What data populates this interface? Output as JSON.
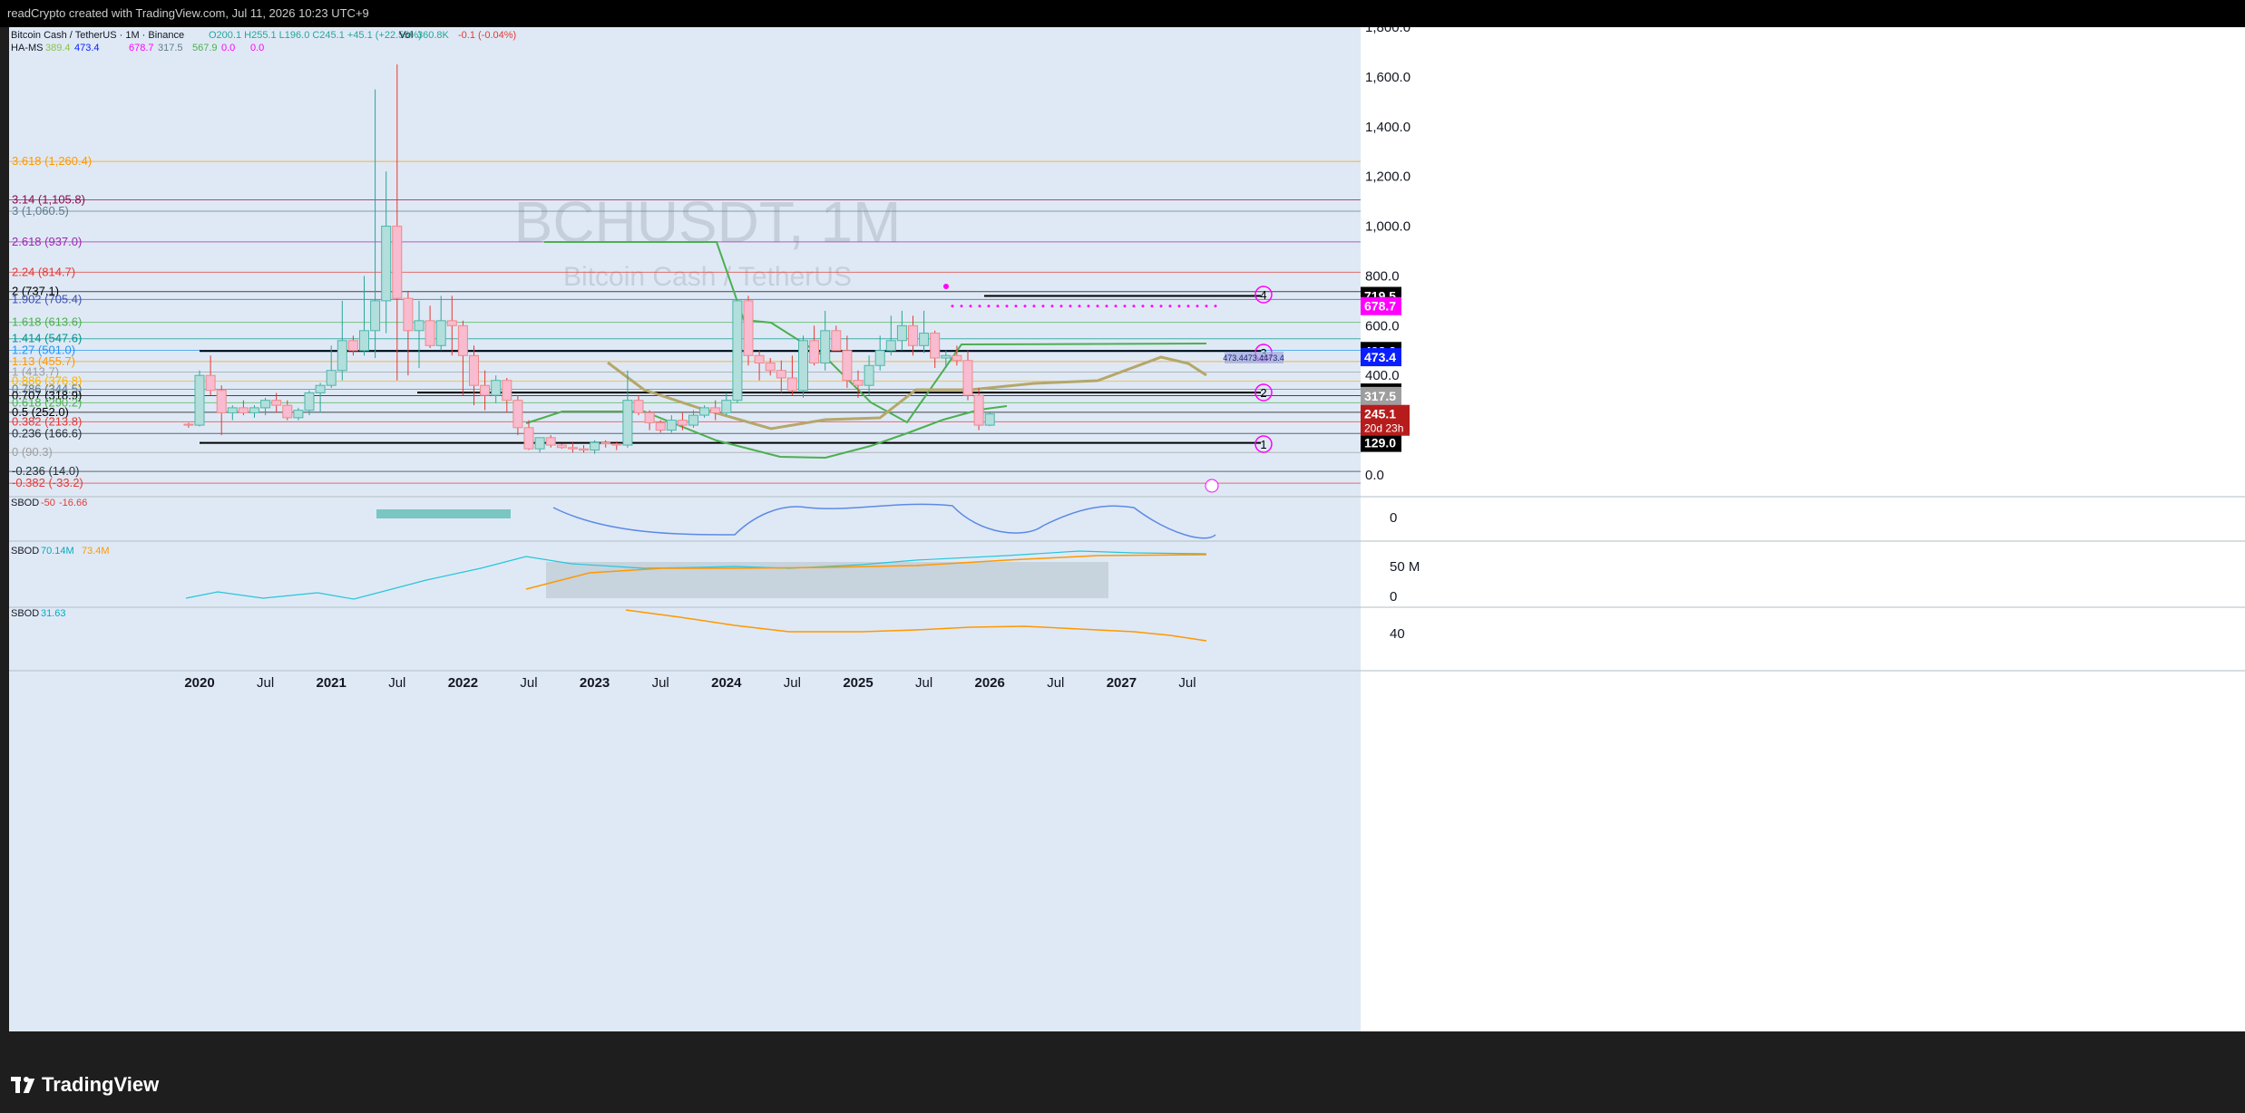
{
  "header": {
    "credit": "readCrypto created with TradingView.com, Jul 11, 2026 10:23 UTC+9"
  },
  "legend": {
    "symbol": "Bitcoin Cash / TetherUS · 1M · Binance",
    "ohlc": "O200.1 H255.1 L196.0 C245.1 +45.1 (+22.55%)",
    "vol_label": "Vol",
    "vol_value": "360.8K",
    "vol_change": "-0.1 (-0.04%)",
    "hams_name": "HA-MS",
    "hams_values": [
      "389.4",
      "473.4",
      "678.7",
      "317.5",
      "567.9",
      "0.0",
      "0.0"
    ]
  },
  "watermark": {
    "ticker": "BCHUSDT, 1M",
    "name": "Bitcoin Cash / TetherUS"
  },
  "colors": {
    "pane_bg": "#dfe9f5",
    "bull": "#4db6ac",
    "bear": "#ef8a8a",
    "tag_black": "#000000",
    "tag_blue": "#0a1eff",
    "tag_magenta": "#ff00ff",
    "tag_gray": "#9e9e9e",
    "tag_last": "#b71c1c",
    "fib_line": "#ff9800"
  },
  "price_axis": {
    "ticks": [
      {
        "v": 1800,
        "label": "1,800.0"
      },
      {
        "v": 1600,
        "label": "1,600.0"
      },
      {
        "v": 1400,
        "label": "1,400.0"
      },
      {
        "v": 1200,
        "label": "1,200.0"
      },
      {
        "v": 1000,
        "label": "1,000.0"
      },
      {
        "v": 800,
        "label": "800.0"
      },
      {
        "v": 600,
        "label": "600.0"
      },
      {
        "v": 400,
        "label": "400.0"
      },
      {
        "v": 0,
        "label": "0.0"
      }
    ],
    "tags": [
      {
        "v": 719.5,
        "label": "719.5",
        "color": "#000000"
      },
      {
        "v": 678.7,
        "label": "678.7",
        "color": "#ff00ff"
      },
      {
        "v": 498.2,
        "label": "498.2",
        "color": "#000000"
      },
      {
        "v": 473.4,
        "label": "473.4",
        "color": "#0a1eff"
      },
      {
        "v": 331.2,
        "label": "331.2",
        "color": "#000000"
      },
      {
        "v": 317.5,
        "label": "317.5",
        "color": "#9e9e9e"
      },
      {
        "v": 129.0,
        "label": "129.0",
        "color": "#000000"
      }
    ],
    "last": {
      "v": 245.1,
      "label": "245.1",
      "countdown": "20d 23h"
    }
  },
  "time_axis": [
    "2020",
    "Jul",
    "2021",
    "Jul",
    "2022",
    "Jul",
    "2023",
    "Jul",
    "2024",
    "Jul",
    "2025",
    "Jul",
    "2026",
    "Jul",
    "2027",
    "Jul"
  ],
  "indicators": {
    "sbod1": {
      "name": "SBOD",
      "v1": "-50",
      "v2": "-16.66",
      "axis": "0"
    },
    "sbod2": {
      "name": "SBOD",
      "v1": "70.14M",
      "v2": "73.4M",
      "axis_top": "50 M",
      "axis_bottom": "0"
    },
    "sbod3": {
      "name": "SBOD",
      "v1": "31.63",
      "axis": "40"
    }
  },
  "circle_labels": [
    "1",
    "2",
    "3",
    "4"
  ],
  "box_label": "473.4473.4473.4",
  "chart_data": {
    "type": "candlestick",
    "title": "BCHUSDT, 1M",
    "subtitle": "Bitcoin Cash / TetherUS",
    "x": [
      "2019-12",
      "2020-01",
      "2020-02",
      "2020-03",
      "2020-04",
      "2020-05",
      "2020-06",
      "2020-07",
      "2020-08",
      "2020-09",
      "2020-10",
      "2020-11",
      "2020-12",
      "2021-01",
      "2021-02",
      "2021-03",
      "2021-04",
      "2021-05",
      "2021-06",
      "2021-07",
      "2021-08",
      "2021-09",
      "2021-10",
      "2021-11",
      "2021-12",
      "2022-01",
      "2022-02",
      "2022-03",
      "2022-04",
      "2022-05",
      "2022-06",
      "2022-07",
      "2022-08",
      "2022-09",
      "2022-10",
      "2022-11",
      "2022-12",
      "2023-01",
      "2023-02",
      "2023-03",
      "2023-04",
      "2023-05",
      "2023-06",
      "2023-07",
      "2023-08",
      "2023-09",
      "2023-10",
      "2023-11",
      "2023-12",
      "2024-01",
      "2024-02",
      "2024-03",
      "2024-04",
      "2024-05",
      "2024-06",
      "2024-07",
      "2024-08",
      "2024-09",
      "2024-10",
      "2024-11",
      "2024-12",
      "2025-01",
      "2025-02",
      "2025-03",
      "2025-04",
      "2025-05",
      "2025-06",
      "2025-07",
      "2025-08",
      "2025-09",
      "2025-10",
      "2025-11",
      "2025-12",
      "2026-01",
      "2026-02",
      "2026-03",
      "2026-04",
      "2026-05",
      "2026-06",
      "2026-07"
    ],
    "ohlc": [
      [
        204,
        210,
        190,
        200
      ],
      [
        200,
        420,
        195,
        400
      ],
      [
        400,
        480,
        320,
        340
      ],
      [
        340,
        360,
        160,
        250
      ],
      [
        250,
        280,
        220,
        270
      ],
      [
        270,
        300,
        240,
        250
      ],
      [
        250,
        280,
        230,
        270
      ],
      [
        270,
        310,
        240,
        300
      ],
      [
        300,
        330,
        250,
        280
      ],
      [
        280,
        300,
        220,
        230
      ],
      [
        230,
        270,
        220,
        260
      ],
      [
        260,
        340,
        240,
        330
      ],
      [
        330,
        370,
        250,
        360
      ],
      [
        360,
        520,
        350,
        420
      ],
      [
        420,
        700,
        380,
        540
      ],
      [
        540,
        560,
        480,
        500
      ],
      [
        500,
        800,
        480,
        580
      ],
      [
        580,
        1550,
        470,
        700
      ],
      [
        700,
        1220,
        570,
        1000
      ],
      [
        1000,
        1650,
        380,
        710
      ],
      [
        710,
        740,
        400,
        580
      ],
      [
        580,
        700,
        430,
        620
      ],
      [
        620,
        680,
        510,
        520
      ],
      [
        520,
        720,
        500,
        620
      ],
      [
        620,
        720,
        480,
        600
      ],
      [
        600,
        620,
        320,
        480
      ],
      [
        480,
        520,
        280,
        360
      ],
      [
        360,
        420,
        260,
        320
      ],
      [
        320,
        400,
        290,
        380
      ],
      [
        380,
        390,
        250,
        300
      ],
      [
        300,
        320,
        160,
        190
      ],
      [
        190,
        220,
        100,
        105
      ],
      [
        105,
        150,
        90,
        150
      ],
      [
        150,
        160,
        110,
        120
      ],
      [
        120,
        125,
        105,
        110
      ],
      [
        110,
        130,
        90,
        105
      ],
      [
        105,
        120,
        90,
        100
      ],
      [
        100,
        140,
        85,
        130
      ],
      [
        130,
        140,
        110,
        125
      ],
      [
        125,
        135,
        100,
        120
      ],
      [
        120,
        420,
        110,
        300
      ],
      [
        300,
        320,
        240,
        250
      ],
      [
        250,
        260,
        180,
        210
      ],
      [
        210,
        220,
        170,
        180
      ],
      [
        180,
        240,
        170,
        220
      ],
      [
        220,
        250,
        180,
        200
      ],
      [
        200,
        260,
        190,
        240
      ],
      [
        240,
        280,
        230,
        270
      ],
      [
        270,
        300,
        220,
        250
      ],
      [
        250,
        330,
        240,
        300
      ],
      [
        300,
        700,
        290,
        700
      ],
      [
        700,
        720,
        440,
        480
      ],
      [
        480,
        500,
        380,
        450
      ],
      [
        450,
        470,
        400,
        420
      ],
      [
        420,
        460,
        330,
        390
      ],
      [
        390,
        480,
        320,
        340
      ],
      [
        340,
        560,
        310,
        540
      ],
      [
        540,
        600,
        440,
        450
      ],
      [
        450,
        660,
        420,
        580
      ],
      [
        580,
        600,
        500,
        500
      ],
      [
        500,
        560,
        350,
        380
      ],
      [
        380,
        420,
        310,
        360
      ],
      [
        360,
        480,
        320,
        440
      ],
      [
        440,
        560,
        420,
        500
      ],
      [
        500,
        640,
        480,
        540
      ],
      [
        540,
        660,
        500,
        600
      ],
      [
        600,
        640,
        480,
        520
      ],
      [
        520,
        660,
        490,
        570
      ],
      [
        570,
        580,
        430,
        470
      ],
      [
        470,
        500,
        430,
        480
      ],
      [
        480,
        520,
        440,
        460
      ],
      [
        460,
        500,
        300,
        320
      ],
      [
        320,
        350,
        180,
        200
      ],
      [
        200,
        255,
        196,
        245
      ]
    ],
    "fib_levels": [
      {
        "ratio": "3.618",
        "value": 1260.4,
        "label": "3.618 (1,260.4)",
        "color": "#ff9800"
      },
      {
        "ratio": "3.14",
        "value": 1105.8,
        "label": "3.14 (1,105.8)",
        "color": "#880e4f"
      },
      {
        "ratio": "3",
        "value": 1060.5,
        "label": "3 (1,060.5)",
        "color": "#607d8b"
      },
      {
        "ratio": "2.618",
        "value": 937.0,
        "label": "2.618 (937.0)",
        "color": "#9c27b0"
      },
      {
        "ratio": "2.24",
        "value": 814.7,
        "label": "2.24 (814.7)",
        "color": "#e53935"
      },
      {
        "ratio": "2",
        "value": 737.1,
        "label": "2 (737.1)",
        "color": "#000000"
      },
      {
        "ratio": "1.902",
        "value": 705.4,
        "label": "1.902 (705.4)",
        "color": "#3f51b5"
      },
      {
        "ratio": "1.618",
        "value": 613.6,
        "label": "1.618 (613.6)",
        "color": "#4caf50"
      },
      {
        "ratio": "1.414",
        "value": 547.6,
        "label": "1.414 (547.6)",
        "color": "#009688"
      },
      {
        "ratio": "1.27",
        "value": 501.0,
        "label": "1.27 (501.0)",
        "color": "#2196f3"
      },
      {
        "ratio": "1.13",
        "value": 455.7,
        "label": "1.13 (455.7)",
        "color": "#ff9800"
      },
      {
        "ratio": "1",
        "value": 413.7,
        "label": "1 (413.7)",
        "color": "#9e9e9e"
      },
      {
        "ratio": "0.886",
        "value": 376.8,
        "label": "0.886 (376.8)",
        "color": "#ffb300"
      },
      {
        "ratio": "0.786",
        "value": 344.5,
        "label": "0.786 (344.5)",
        "color": "#607d8b"
      },
      {
        "ratio": "0.707",
        "value": 318.9,
        "label": "0.707 (318.9)",
        "color": "#000000"
      },
      {
        "ratio": "0.618",
        "value": 290.2,
        "label": "0.618 (290.2)",
        "color": "#4caf50"
      },
      {
        "ratio": "0.5",
        "value": 252.0,
        "label": "0.5 (252.0)",
        "color": "#000000"
      },
      {
        "ratio": "0.382",
        "value": 213.8,
        "label": "0.382 (213.8)",
        "color": "#e53935"
      },
      {
        "ratio": "0.236",
        "value": 166.6,
        "label": "0.236 (166.6)",
        "color": "#263238"
      },
      {
        "ratio": "0",
        "value": 90.3,
        "label": "0 (90.3)",
        "color": "#9e9e9e"
      },
      {
        "ratio": "-0.236",
        "value": 14.0,
        "label": "-0.236 (14.0)",
        "color": "#263238"
      },
      {
        "ratio": "-0.382",
        "value": -33.2,
        "label": "-0.382 (-33.2)",
        "color": "#e53935"
      }
    ],
    "ylim": [
      -80,
      1850
    ],
    "xlim_months": [
      "2019-05",
      "2027-10"
    ]
  }
}
